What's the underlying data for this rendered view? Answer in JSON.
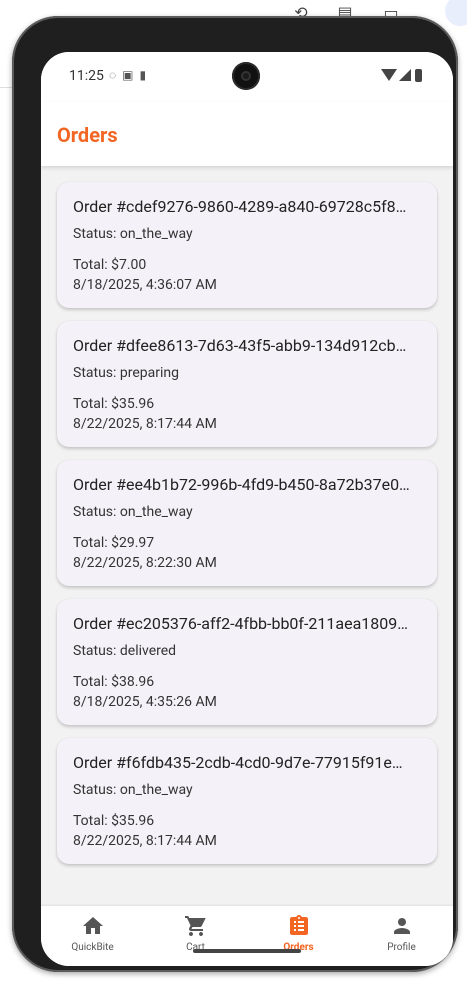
{
  "app": {
    "title": "Orders"
  },
  "statusbar": {
    "time": "11:25",
    "icons": [
      "vpn-icon",
      "tile-icon",
      "sd-card-icon"
    ],
    "right_icons": [
      "wifi-icon",
      "signal-icon",
      "battery-icon"
    ]
  },
  "orders": [
    {
      "id_label": "Order #cdef9276-9860-4289-a840-69728c5f8…",
      "status": "Status: on_the_way",
      "total": "Total: $7.00",
      "date": "8/18/2025, 4:36:07 AM"
    },
    {
      "id_label": "Order #dfee8613-7d63-43f5-abb9-134d912cb…",
      "status": "Status: preparing",
      "total": "Total: $35.96",
      "date": "8/22/2025, 8:17:44 AM"
    },
    {
      "id_label": "Order #ee4b1b72-996b-4fd9-b450-8a72b37e0…",
      "status": "Status: on_the_way",
      "total": "Total: $29.97",
      "date": "8/22/2025, 8:22:30 AM"
    },
    {
      "id_label": "Order #ec205376-aff2-4fbb-bb0f-211aea1809…",
      "status": "Status: delivered",
      "total": "Total: $38.96",
      "date": "8/18/2025, 4:35:26 AM"
    },
    {
      "id_label": "Order #f6fdb435-2cdb-4cd0-9d7e-77915f91e…",
      "status": "Status: on_the_way",
      "total": "Total: $35.96",
      "date": "8/22/2025, 8:17:44 AM"
    }
  ],
  "bottom_nav": [
    {
      "label": "QuickBite",
      "icon": "home-icon",
      "active": false
    },
    {
      "label": "Cart",
      "icon": "cart-icon",
      "active": false
    },
    {
      "label": "Orders",
      "icon": "orders-icon",
      "active": true
    },
    {
      "label": "Profile",
      "icon": "profile-icon",
      "active": false
    }
  ],
  "colors": {
    "accent": "#f26522",
    "card_bg": "#f5f1f8",
    "screen_bg": "#f2f2f2"
  }
}
